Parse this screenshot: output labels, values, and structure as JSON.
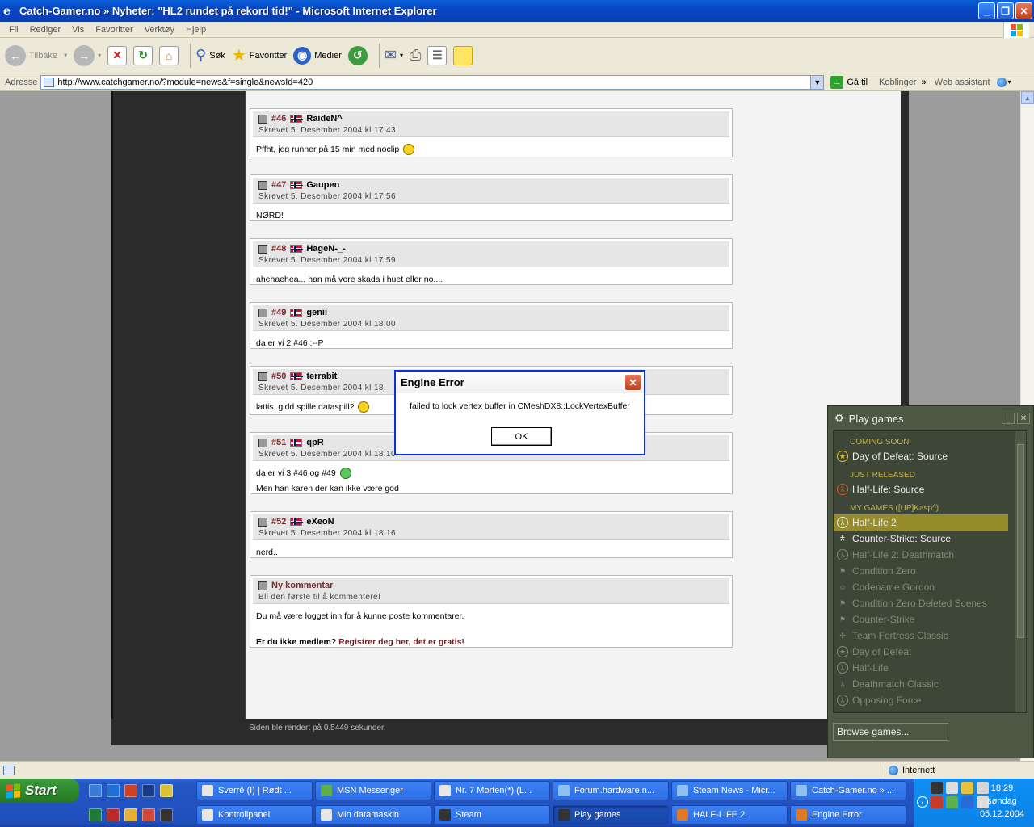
{
  "ie": {
    "title": "Catch-Gamer.no » Nyheter: \"HL2 rundet på rekord tid!\" - Microsoft Internet Explorer",
    "menu": [
      "Fil",
      "Rediger",
      "Vis",
      "Favoritter",
      "Verktøy",
      "Hjelp"
    ],
    "toolbar": {
      "back": "Tilbake",
      "search": "Søk",
      "favorites": "Favoritter",
      "media": "Medier"
    },
    "address_label": "Adresse",
    "url": "http://www.catchgamer.no/?module=news&f=single&newsId=420",
    "go": "Gå til",
    "links": "Koblinger",
    "web_assistant": "Web assistant",
    "status_zone": "Internett"
  },
  "comments": [
    {
      "num": "#46",
      "author": "RaideN^",
      "date": "Skrevet 5. Desember 2004 kl 17:43",
      "lines": [
        "Pffht, jeg runner på 15 min med noclip"
      ]
    },
    {
      "num": "#47",
      "author": "Gaupen",
      "date": "Skrevet 5. Desember 2004 kl 17:56",
      "lines": [
        "NØRD!"
      ]
    },
    {
      "num": "#48",
      "author": "HageN-_-",
      "date": "Skrevet 5. Desember 2004 kl 17:59",
      "lines": [
        "ahehaehea... han må vere skada i huet eller no...."
      ]
    },
    {
      "num": "#49",
      "author": "genii",
      "date": "Skrevet 5. Desember 2004 kl 18:00",
      "lines": [
        "da er vi 2 #46 ;--P"
      ]
    },
    {
      "num": "#50",
      "author": "terrabit",
      "date": "Skrevet 5. Desember 2004 kl 18:",
      "lines": [
        "lattis, gidd spille dataspill?"
      ]
    },
    {
      "num": "#51",
      "author": "qpR",
      "date": "Skrevet 5. Desember 2004 kl 18:10",
      "lines": [
        "da er vi 3 #46 og #49",
        "Men han karen der kan ikke være god"
      ]
    },
    {
      "num": "#52",
      "author": "eXeoN",
      "date": "Skrevet 5. Desember 2004 kl 18:16",
      "lines": [
        "nerd.."
      ]
    }
  ],
  "new_comment": {
    "title": "Ny kommentar",
    "subtitle": "Bli den første til å kommentere!",
    "login_msg": "Du må være logget inn for å kunne poste kommentarer.",
    "not_member": "Er du ikke medlem?",
    "register_link": "Registrer deg her, det er gratis!"
  },
  "render_note": "Siden ble rendert på 0.5449 sekunder.",
  "error_dialog": {
    "title": "Engine Error",
    "message": "failed to lock vertex buffer in CMeshDX8::LockVertexBuffer",
    "ok": "OK"
  },
  "steam": {
    "title": "Play games",
    "sections": {
      "coming_soon": "COMING SOON",
      "just_released": "JUST RELEASED",
      "my_games": "MY GAMES ([UP]Kasp^)"
    },
    "coming_soon": [
      "Day of Defeat: Source"
    ],
    "just_released": [
      "Half-Life: Source"
    ],
    "my_games": [
      "Half-Life 2",
      "Counter-Strike: Source",
      "Half-Life 2: Deathmatch",
      "Condition Zero",
      "Codename Gordon",
      "Condition Zero Deleted Scenes",
      "Counter-Strike",
      "Team Fortress Classic",
      "Day of Defeat",
      "Half-Life",
      "Deathmatch Classic",
      "Opposing Force"
    ],
    "browse": "Browse games..."
  },
  "taskbar": {
    "start": "Start",
    "row1": [
      "Sverrë (I) | Rødt ...",
      "MSN Messenger",
      "Nr. 7 Morten(*) (L...",
      "Forum.hardware.n...",
      "Steam News - Micr...",
      "Catch-Gamer.no » ..."
    ],
    "row2": [
      "Kontrollpanel",
      "Min datamaskin",
      "Steam",
      "Play games",
      "HALF-LIFE 2",
      "Engine Error"
    ],
    "time": "18:29",
    "day": "søndag",
    "date": "05.12.2004"
  }
}
